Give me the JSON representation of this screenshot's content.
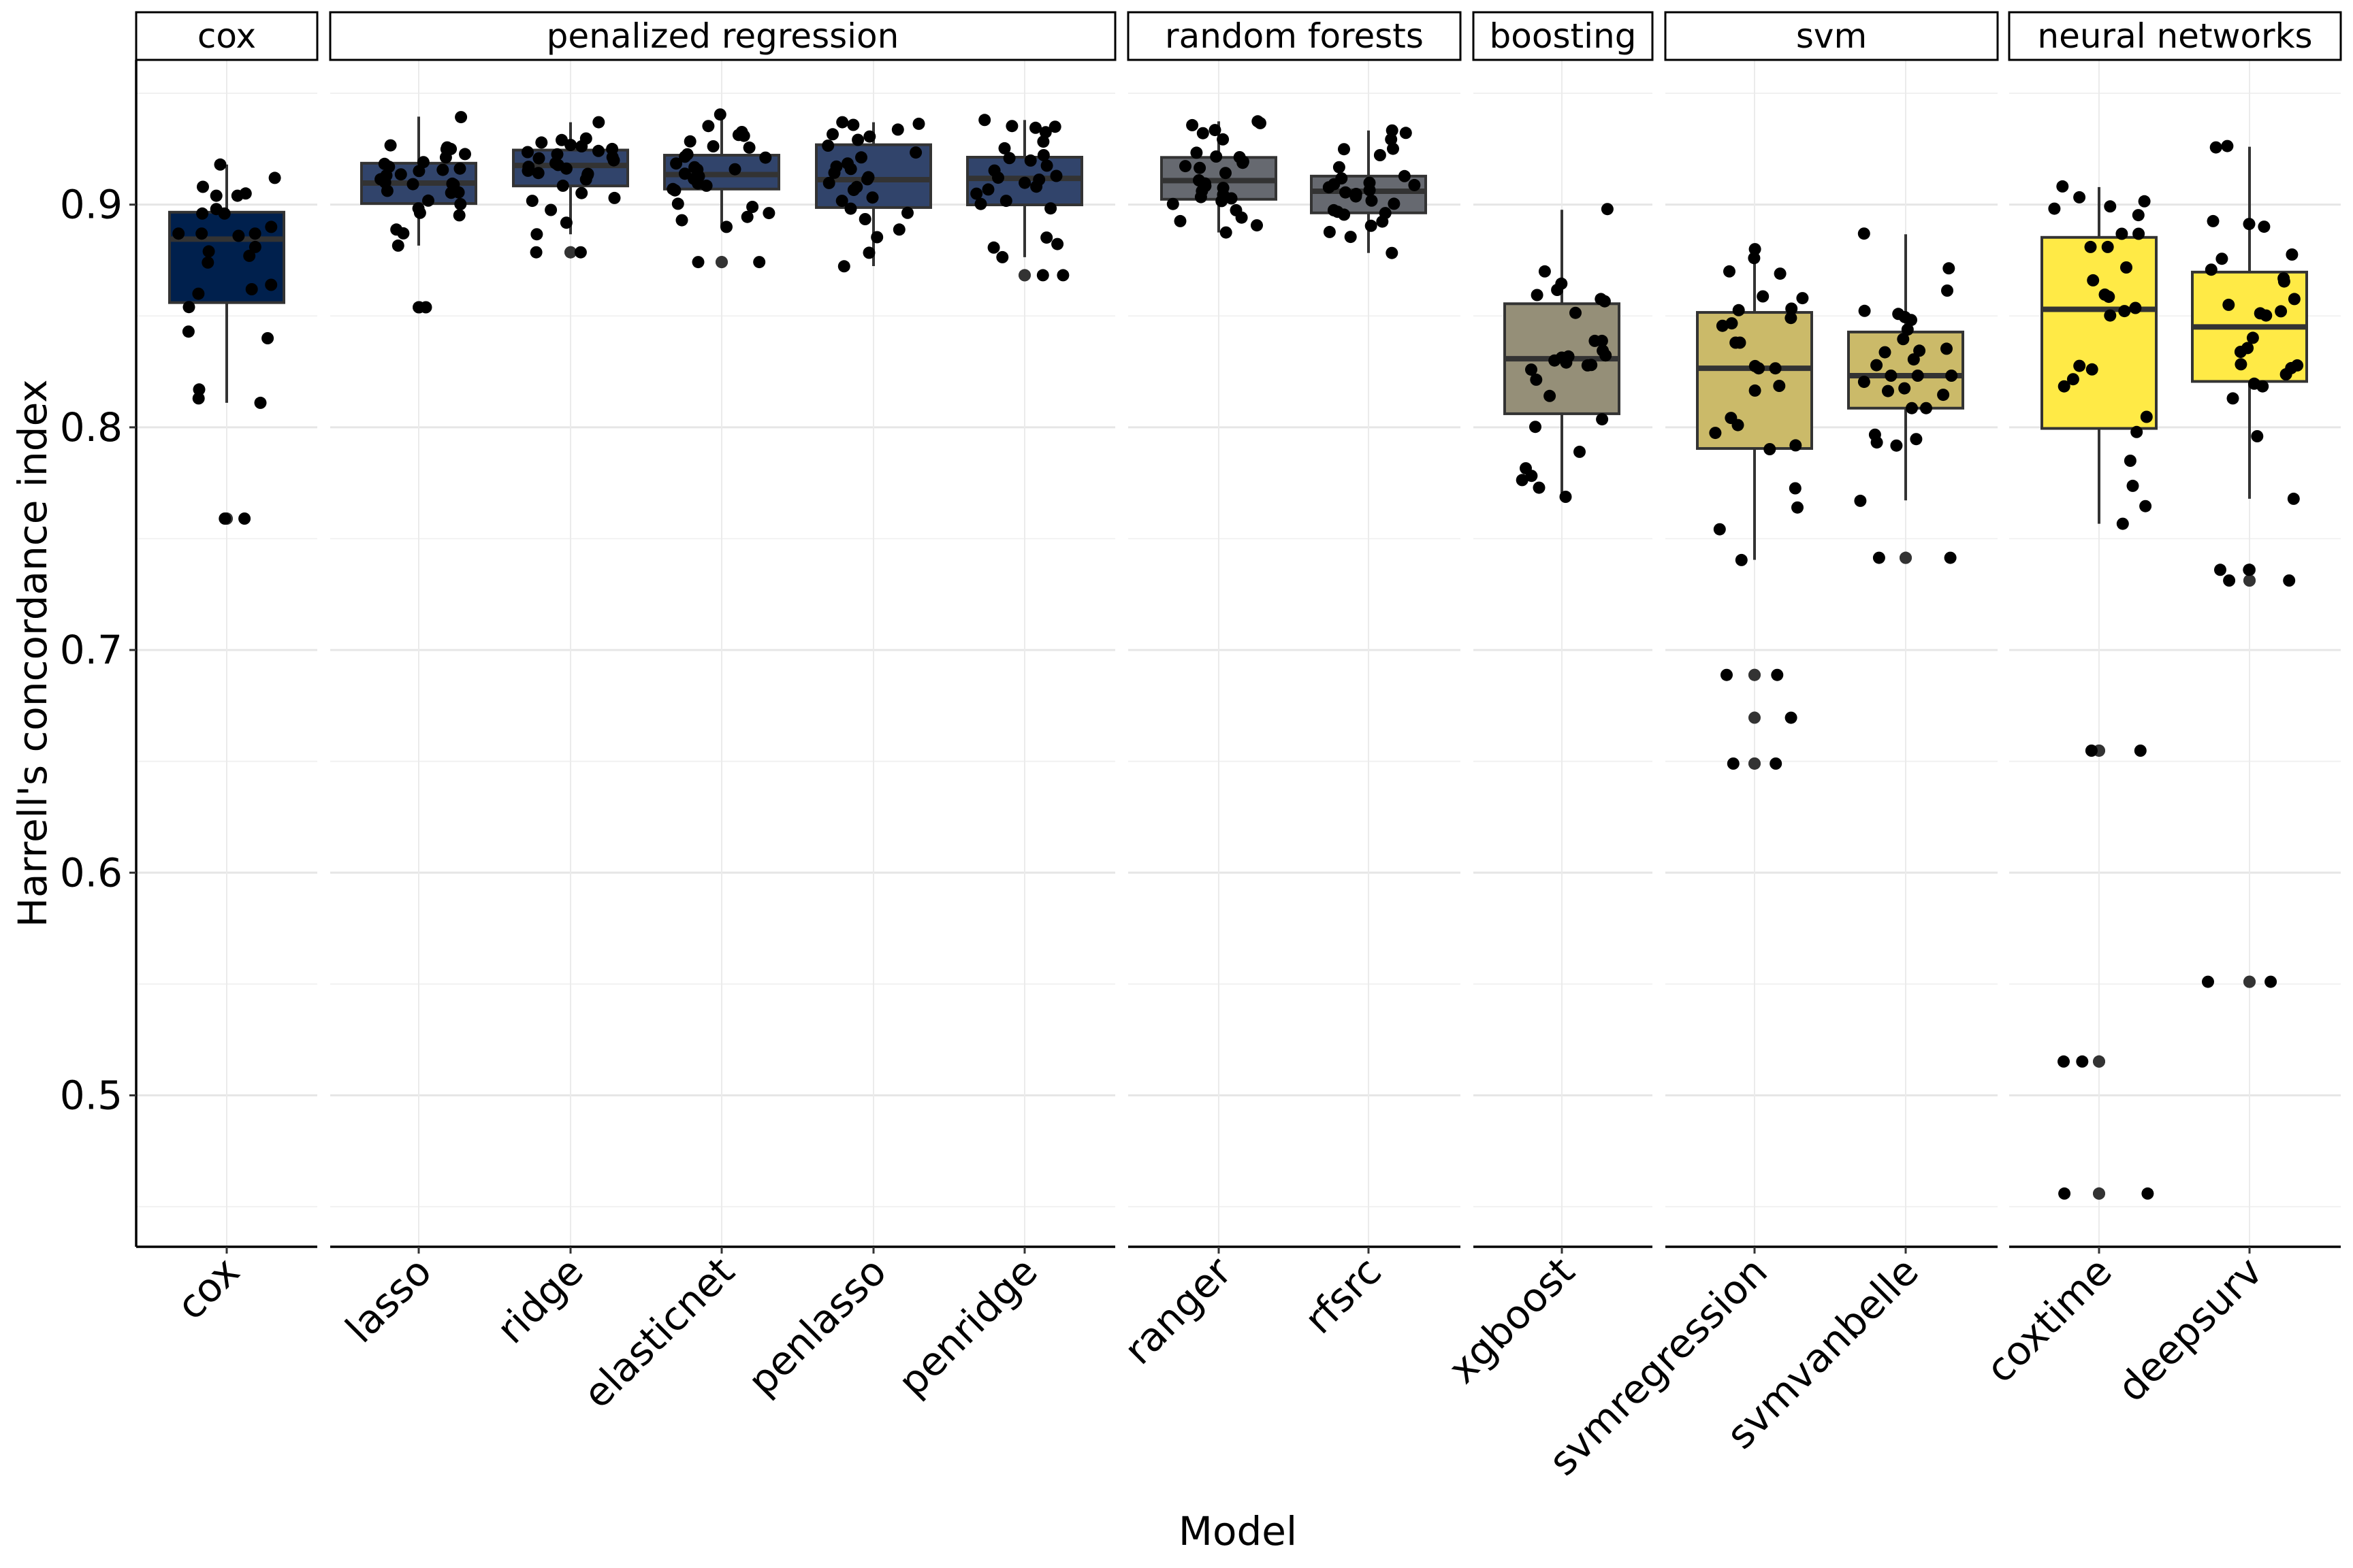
{
  "chart_data": {
    "type": "boxplot",
    "title": "",
    "xlabel": "Model",
    "ylabel": "Harrell's concordance index",
    "ylim": [
      0.432,
      0.965
    ],
    "yticks": [
      0.5,
      0.6,
      0.7,
      0.8,
      0.9
    ],
    "ytick_labels": [
      "0.5",
      "0.6",
      "0.7",
      "0.8",
      "0.9"
    ],
    "grid": true,
    "legend": "none",
    "facets": [
      {
        "label": "cox",
        "fill": "#00204D",
        "models": [
          "cox"
        ]
      },
      {
        "label": "penalized regression",
        "fill": "#31446B",
        "models": [
          "lasso",
          "ridge",
          "elasticnet",
          "penlasso",
          "penridge"
        ]
      },
      {
        "label": "random forests",
        "fill": "#666970",
        "models": [
          "ranger",
          "rfsrc"
        ]
      },
      {
        "label": "boosting",
        "fill": "#958F78",
        "models": [
          "xgboost"
        ]
      },
      {
        "label": "svm",
        "fill": "#CBBA69",
        "models": [
          "svmregression",
          "svmvanbelle"
        ]
      },
      {
        "label": "neural networks",
        "fill": "#FFEA46",
        "models": [
          "coxtime",
          "deepsurv"
        ]
      }
    ],
    "categories": [
      "cox",
      "lasso",
      "ridge",
      "elasticnet",
      "penlasso",
      "penridge",
      "ranger",
      "rfsrc",
      "xgboost",
      "svmregression",
      "svmvanbelle",
      "coxtime",
      "deepsurv"
    ],
    "boxes": {
      "cox": {
        "whisker_low": 0.811,
        "q1": 0.856,
        "median": 0.8845,
        "q3": 0.8966,
        "whisker_high": 0.918,
        "outliers": [
          0.759,
          0.759
        ]
      },
      "lasso": {
        "whisker_low": 0.8816,
        "q1": 0.9005,
        "median": 0.9097,
        "q3": 0.9186,
        "whisker_high": 0.9395,
        "outliers": [
          0.8539,
          0.8539
        ]
      },
      "ridge": {
        "whisker_low": 0.8867,
        "q1": 0.9084,
        "median": 0.9176,
        "q3": 0.9245,
        "whisker_high": 0.937,
        "outliers": [
          0.8786,
          0.8786
        ]
      },
      "elasticnet": {
        "whisker_low": 0.89,
        "q1": 0.907,
        "median": 0.9135,
        "q3": 0.9222,
        "whisker_high": 0.9405,
        "outliers": [
          0.8742,
          0.8742
        ]
      },
      "penlasso": {
        "whisker_low": 0.8724,
        "q1": 0.8987,
        "median": 0.9112,
        "q3": 0.9269,
        "whisker_high": 0.937,
        "outliers": []
      },
      "penridge": {
        "whisker_low": 0.8764,
        "q1": 0.8999,
        "median": 0.9118,
        "q3": 0.9213,
        "whisker_high": 0.938,
        "outliers": [
          0.8683,
          0.8683
        ]
      },
      "ranger": {
        "whisker_low": 0.8875,
        "q1": 0.9024,
        "median": 0.9108,
        "q3": 0.9212,
        "whisker_high": 0.9374,
        "outliers": []
      },
      "rfsrc": {
        "whisker_low": 0.8783,
        "q1": 0.8963,
        "median": 0.906,
        "q3": 0.9128,
        "whisker_high": 0.9333,
        "outliers": []
      },
      "xgboost": {
        "whisker_low": 0.7688,
        "q1": 0.8061,
        "median": 0.8308,
        "q3": 0.8555,
        "whisker_high": 0.8977,
        "outliers": []
      },
      "svmregression": {
        "whisker_low": 0.7405,
        "q1": 0.7905,
        "median": 0.8265,
        "q3": 0.8516,
        "whisker_high": 0.8796,
        "outliers": [
          0.6888,
          0.6888,
          0.6696,
          0.649,
          0.649
        ]
      },
      "svmvanbelle": {
        "whisker_low": 0.7672,
        "q1": 0.8086,
        "median": 0.8232,
        "q3": 0.8428,
        "whisker_high": 0.8867,
        "outliers": [
          0.7414,
          0.7414
        ]
      },
      "coxtime": {
        "whisker_low": 0.7567,
        "q1": 0.7995,
        "median": 0.853,
        "q3": 0.8853,
        "whisker_high": 0.9079,
        "outliers": [
          0.6548,
          0.6548,
          0.5152,
          0.5152,
          0.4559,
          0.4559
        ]
      },
      "deepsurv": {
        "whisker_low": 0.7679,
        "q1": 0.8206,
        "median": 0.8451,
        "q3": 0.8697,
        "whisker_high": 0.926,
        "outliers": [
          0.736,
          0.736,
          0.7312,
          0.7312,
          0.551,
          0.551
        ]
      }
    },
    "points": {
      "cox": [
        0.918,
        0.912,
        0.908,
        0.905,
        0.904,
        0.904,
        0.898,
        0.896,
        0.896,
        0.89,
        0.887,
        0.887,
        0.887,
        0.886,
        0.881,
        0.879,
        0.877,
        0.874,
        0.864,
        0.862,
        0.86,
        0.854,
        0.843,
        0.84,
        0.817,
        0.813,
        0.811,
        0.759,
        0.759
      ],
      "lasso": [
        0.9393,
        0.9266,
        0.9257,
        0.925,
        0.9249,
        0.9227,
        0.9212,
        0.9191,
        0.9183,
        0.917,
        0.9162,
        0.9156,
        0.9151,
        0.9136,
        0.9131,
        0.9114,
        0.91,
        0.9094,
        0.9092,
        0.909,
        0.9062,
        0.9055,
        0.9053,
        0.9018,
        0.9002,
        0.8983,
        0.8963,
        0.8952,
        0.8888,
        0.8871,
        0.8816,
        0.8539,
        0.8539
      ],
      "ridge": [
        0.937,
        0.9297,
        0.929,
        0.9279,
        0.9268,
        0.9262,
        0.925,
        0.9241,
        0.9236,
        0.9226,
        0.9213,
        0.9208,
        0.9199,
        0.9186,
        0.9178,
        0.917,
        0.9162,
        0.9152,
        0.9142,
        0.9138,
        0.9133,
        0.9113,
        0.9085,
        0.9052,
        0.903,
        0.9017,
        0.8976,
        0.8919,
        0.8867,
        0.8786,
        0.8786
      ],
      "elasticnet": [
        0.9405,
        0.9353,
        0.9326,
        0.9313,
        0.9309,
        0.9284,
        0.9262,
        0.9256,
        0.9226,
        0.9215,
        0.9211,
        0.9185,
        0.9168,
        0.9159,
        0.9157,
        0.9139,
        0.9127,
        0.9116,
        0.9109,
        0.9095,
        0.9085,
        0.907,
        0.9064,
        0.9004,
        0.899,
        0.8962,
        0.8945,
        0.893,
        0.89,
        0.8742,
        0.8742
      ],
      "penlasso": [
        0.937,
        0.9363,
        0.9358,
        0.9337,
        0.9316,
        0.9306,
        0.9291,
        0.9265,
        0.9234,
        0.9212,
        0.9185,
        0.9171,
        0.916,
        0.9143,
        0.9123,
        0.9114,
        0.9097,
        0.9079,
        0.9066,
        0.9032,
        0.9017,
        0.8982,
        0.8963,
        0.8935,
        0.8888,
        0.8854,
        0.8784,
        0.8723
      ],
      "penridge": [
        0.938,
        0.9353,
        0.935,
        0.9345,
        0.9325,
        0.9283,
        0.9253,
        0.9222,
        0.9209,
        0.9198,
        0.9175,
        0.9153,
        0.9129,
        0.9121,
        0.9112,
        0.9098,
        0.9081,
        0.9068,
        0.9049,
        0.9017,
        0.9003,
        0.8983,
        0.8852,
        0.8823,
        0.8807,
        0.8764,
        0.8683,
        0.8683
      ],
      "ranger": [
        0.9374,
        0.9366,
        0.9357,
        0.9335,
        0.9321,
        0.9293,
        0.9233,
        0.9216,
        0.9213,
        0.9193,
        0.9188,
        0.9173,
        0.9165,
        0.9142,
        0.9109,
        0.9095,
        0.9084,
        0.9075,
        0.9061,
        0.9045,
        0.9034,
        0.9028,
        0.9016,
        0.9003,
        0.8975,
        0.8942,
        0.8926,
        0.8907,
        0.8875
      ],
      "rfsrc": [
        0.9333,
        0.9322,
        0.9293,
        0.9251,
        0.9249,
        0.9222,
        0.9168,
        0.9128,
        0.9118,
        0.9098,
        0.9092,
        0.9088,
        0.9078,
        0.9065,
        0.9055,
        0.9048,
        0.9037,
        0.9018,
        0.9004,
        0.8975,
        0.8968,
        0.8962,
        0.8955,
        0.8924,
        0.8905,
        0.8877,
        0.8855,
        0.8783
      ],
      "xgboost": [
        0.898,
        0.87,
        0.8645,
        0.8617,
        0.8594,
        0.8576,
        0.8566,
        0.8514,
        0.8388,
        0.8388,
        0.8344,
        0.8323,
        0.8318,
        0.8313,
        0.83,
        0.8291,
        0.828,
        0.8278,
        0.8259,
        0.8214,
        0.8141,
        0.8036,
        0.8002,
        0.789,
        0.7816,
        0.7782,
        0.7763,
        0.7729,
        0.7688
      ],
      "svmregression": [
        0.88,
        0.876,
        0.87,
        0.869,
        0.8588,
        0.858,
        0.8533,
        0.8526,
        0.8491,
        0.8467,
        0.8456,
        0.838,
        0.838,
        0.8275,
        0.8265,
        0.8265,
        0.8186,
        0.8165,
        0.8042,
        0.801,
        0.7975,
        0.7919,
        0.7902,
        0.7726,
        0.764,
        0.7542,
        0.7404,
        0.6888,
        0.6888,
        0.6696,
        0.649,
        0.649
      ],
      "svmvanbelle": [
        0.887,
        0.8714,
        0.8614,
        0.8523,
        0.8509,
        0.8495,
        0.8482,
        0.8439,
        0.8396,
        0.8353,
        0.8344,
        0.8337,
        0.8305,
        0.8279,
        0.8232,
        0.8232,
        0.8232,
        0.8204,
        0.8175,
        0.8163,
        0.8146,
        0.8086,
        0.8086,
        0.7967,
        0.7947,
        0.7932,
        0.7918,
        0.767,
        0.7414,
        0.7414
      ],
      "coxtime": [
        0.9082,
        0.9033,
        0.9015,
        0.8992,
        0.8982,
        0.8953,
        0.8869,
        0.8869,
        0.881,
        0.881,
        0.8718,
        0.866,
        0.8596,
        0.8586,
        0.8536,
        0.8522,
        0.8502,
        0.8276,
        0.826,
        0.8216,
        0.8184,
        0.8047,
        0.7979,
        0.785,
        0.7737,
        0.7646,
        0.7567,
        0.6548,
        0.6548,
        0.5152,
        0.5152,
        0.4559,
        0.4559
      ],
      "deepsurv": [
        0.9263,
        0.9257,
        0.8926,
        0.8913,
        0.8901,
        0.8776,
        0.8757,
        0.8708,
        0.8669,
        0.8655,
        0.8576,
        0.855,
        0.8521,
        0.8512,
        0.8502,
        0.8402,
        0.8356,
        0.8339,
        0.8283,
        0.8278,
        0.8266,
        0.8238,
        0.8196,
        0.8184,
        0.813,
        0.796,
        0.7679,
        0.736,
        0.736,
        0.7312,
        0.7312,
        0.551,
        0.551
      ]
    }
  }
}
